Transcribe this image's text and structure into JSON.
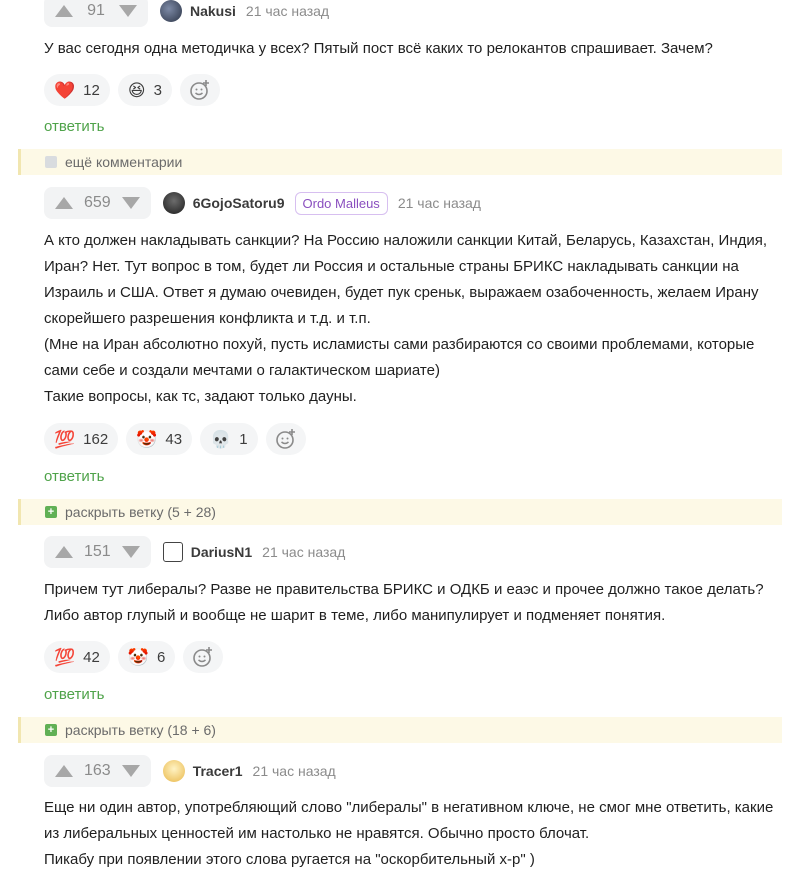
{
  "comments": [
    {
      "votes": "91",
      "user": "Nakusi",
      "time": "21 час назад",
      "text": [
        "У вас сегодня одна методичка у всех? Пятый пост всё каких то релокантов спрашивает. Зачем?"
      ],
      "reactions": [
        {
          "emoji": "❤️",
          "count": "12"
        },
        {
          "emoji": "😆",
          "count": "3"
        }
      ],
      "reply": "ответить"
    },
    {
      "votes": "659",
      "user": "6GojoSatoru9",
      "badge": "Ordo Malleus",
      "time": "21 час назад",
      "text": [
        "А кто должен накладывать санкции? На Россию наложили санкции Китай, Беларусь, Казахстан, Индия, Иран? Нет. Тут вопрос в том, будет ли Россия и остальные страны БРИКС накладывать санкции на Израиль и США. Ответ я думаю очевиден, будет пук среньк, выражаем озабоченность, желаем Ирану скорейшего разрешения конфликта и т.д. и т.п.",
        "(Мне на Иран абсолютно похуй, пусть исламисты сами разбираются со своими проблемами, которые сами себе и создали мечтами о галактическом шариате)",
        "Такие вопросы, как тс, задают только дауны."
      ],
      "reactions": [
        {
          "emoji": "💯",
          "count": "162"
        },
        {
          "emoji": "🤡",
          "count": "43"
        },
        {
          "emoji": "💀",
          "count": "1"
        }
      ],
      "reply": "ответить"
    },
    {
      "votes": "151",
      "user": "DariusN1",
      "time": "21 час назад",
      "text": [
        "Причем тут либералы? Разве не правительства БРИКС и ОДКБ и еаэс и прочее должно такое делать? Либо автор глупый и вообще не шарит в теме, либо манипулирует и подменяет понятия."
      ],
      "reactions": [
        {
          "emoji": "💯",
          "count": "42"
        },
        {
          "emoji": "🤡",
          "count": "6"
        }
      ],
      "reply": "ответить"
    },
    {
      "votes": "163",
      "user": "Tracer1",
      "time": "21 час назад",
      "text": [
        "Еще ни один автор, употребляющий слово \"либералы\" в негативном ключе, не смог мне ответить, какие из либеральных ценностей им настолько не нравятся. Обычно просто блочат.",
        "Пикабу при появлении этого слова ругается на \"оскорбительный х-р\" )"
      ]
    }
  ],
  "branches": {
    "more_comments": "ещё комментарии",
    "expand_1": "раскрыть ветку (5 + 28)",
    "expand_2": "раскрыть ветку (18 + 6)"
  },
  "colors": {
    "accent_green": "#4fa34a",
    "branch_bg": "#fdf9e6",
    "badge_purple": "#8a4fbf"
  }
}
